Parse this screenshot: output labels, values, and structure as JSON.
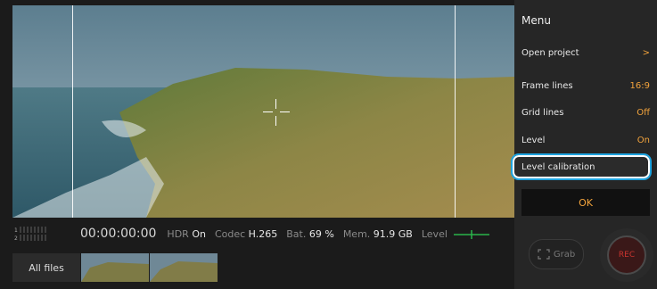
{
  "menu": {
    "title": "Menu",
    "items": [
      {
        "label": "Open project",
        "value": ">"
      },
      {
        "label": "Frame lines",
        "value": "16:9"
      },
      {
        "label": "Grid lines",
        "value": "Off"
      },
      {
        "label": "Level",
        "value": "On"
      },
      {
        "label": "Level calibration",
        "value": ""
      }
    ],
    "ok_label": "OK"
  },
  "status": {
    "audio_channels": [
      "1",
      "2"
    ],
    "timecode": "00:00:00:00",
    "hdr_label": "HDR",
    "hdr_value": "On",
    "codec_label": "Codec",
    "codec_value": "H.265",
    "battery_label": "Bat.",
    "battery_value": "69 %",
    "memory_label": "Mem.",
    "memory_value": "91.9 GB",
    "level_label": "Level"
  },
  "files": {
    "all_files_label": "All files"
  },
  "controls": {
    "grab_label": "Grab",
    "rec_label": "REC"
  },
  "colors": {
    "accent": "#f2a33c",
    "highlight": "#1fa4e0",
    "rec": "#c8342e",
    "level_ok": "#2bb34a"
  }
}
